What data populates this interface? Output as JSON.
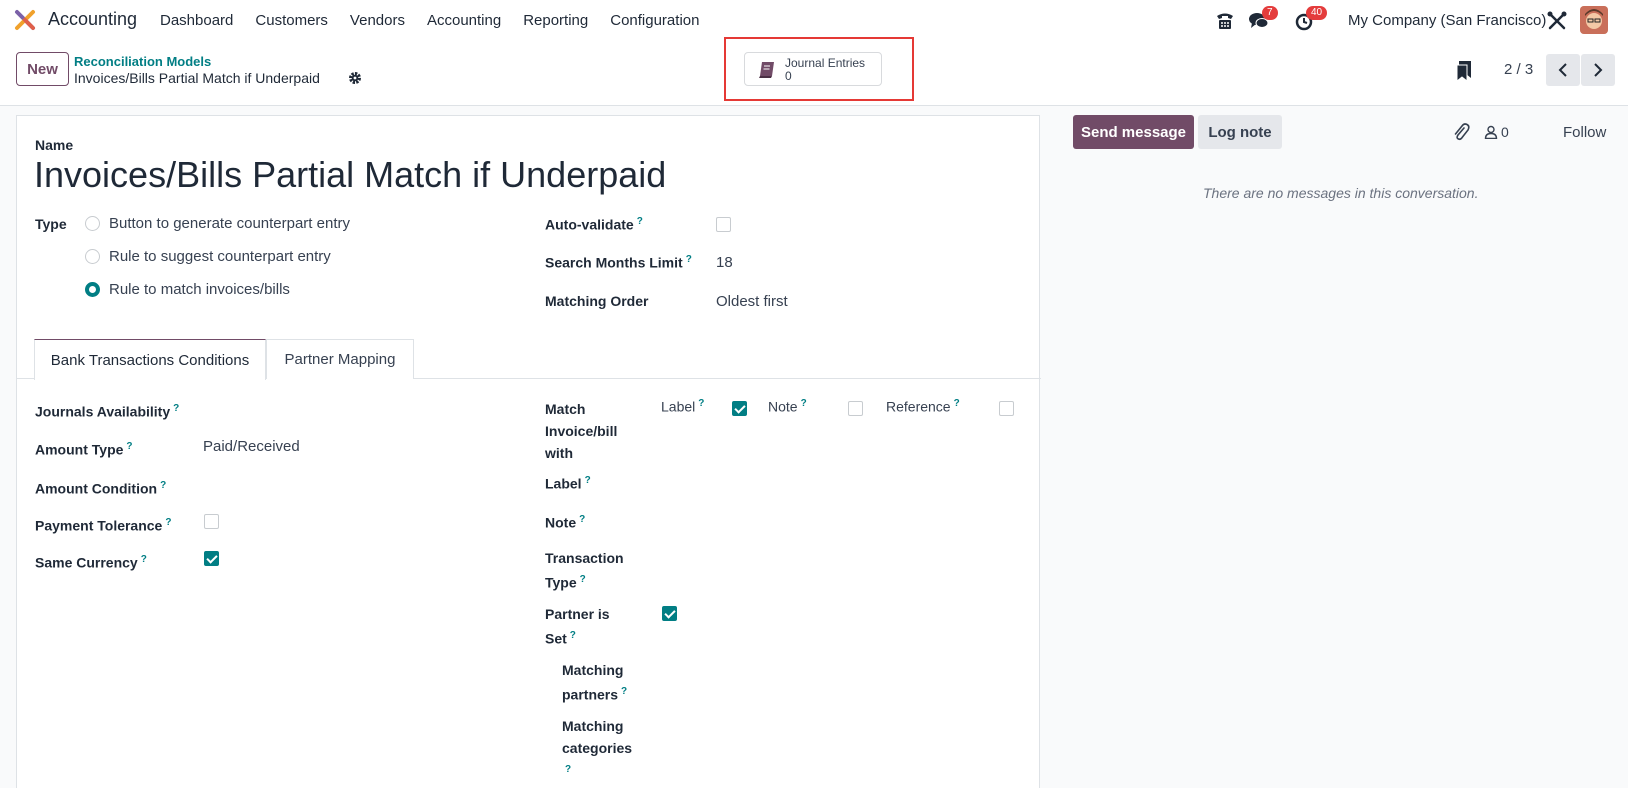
{
  "navbar": {
    "app_name": "Accounting",
    "menu": [
      "Dashboard",
      "Customers",
      "Vendors",
      "Accounting",
      "Reporting",
      "Configuration"
    ],
    "messages_badge": "7",
    "activities_badge": "40",
    "company": "My Company (San Francisco)"
  },
  "control": {
    "new_label": "New",
    "breadcrumb_parent": "Reconciliation Models",
    "breadcrumb_current": "Invoices/Bills Partial Match if Underpaid",
    "smart_button": {
      "label": "Journal Entries",
      "count": "0"
    },
    "pager": "2 / 3"
  },
  "form": {
    "name_label": "Name",
    "name_value": "Invoices/Bills Partial Match if Underpaid",
    "type_label": "Type",
    "type_options": [
      {
        "label": "Button to generate counterpart entry",
        "selected": false
      },
      {
        "label": "Rule to suggest counterpart entry",
        "selected": false
      },
      {
        "label": "Rule to match invoices/bills",
        "selected": true
      }
    ],
    "auto_validate_label": "Auto-validate",
    "auto_validate": false,
    "search_months_label": "Search Months Limit",
    "search_months_value": "18",
    "matching_order_label": "Matching Order",
    "matching_order_value": "Oldest first",
    "help_mark": "?"
  },
  "tabs": [
    "Bank Transactions Conditions",
    "Partner Mapping"
  ],
  "conditions": {
    "journals_availability": "Journals Availability",
    "amount_type": "Amount Type",
    "amount_type_value": "Paid/Received",
    "amount_condition": "Amount Condition",
    "payment_tolerance": "Payment Tolerance",
    "payment_tolerance_checked": false,
    "same_currency": "Same Currency",
    "same_currency_checked": true,
    "match_with_line1": "Match",
    "match_with_line2": "Invoice/bill",
    "match_with_line3": "with",
    "match_label": "Label",
    "match_label_checked": true,
    "match_note": "Note",
    "match_note_checked": false,
    "match_reference": "Reference",
    "match_reference_checked": false,
    "label": "Label",
    "note": "Note",
    "transaction_type_line1": "Transaction",
    "transaction_type_line2": "Type",
    "partner_set_line1": "Partner is",
    "partner_set_line2": "Set",
    "partner_set_checked": true,
    "matching_partners_line1": "Matching",
    "matching_partners_line2": "partners",
    "matching_categories_line1": "Matching",
    "matching_categories_line2": "categories"
  },
  "chatter": {
    "send_message": "Send message",
    "log_note": "Log note",
    "followers_count": "0",
    "follow": "Follow",
    "no_messages": "There are no messages in this conversation."
  },
  "colors": {
    "brand": "#714b67",
    "accent": "#017e84",
    "highlight": "#e53935",
    "badge": "#e43c3c"
  }
}
